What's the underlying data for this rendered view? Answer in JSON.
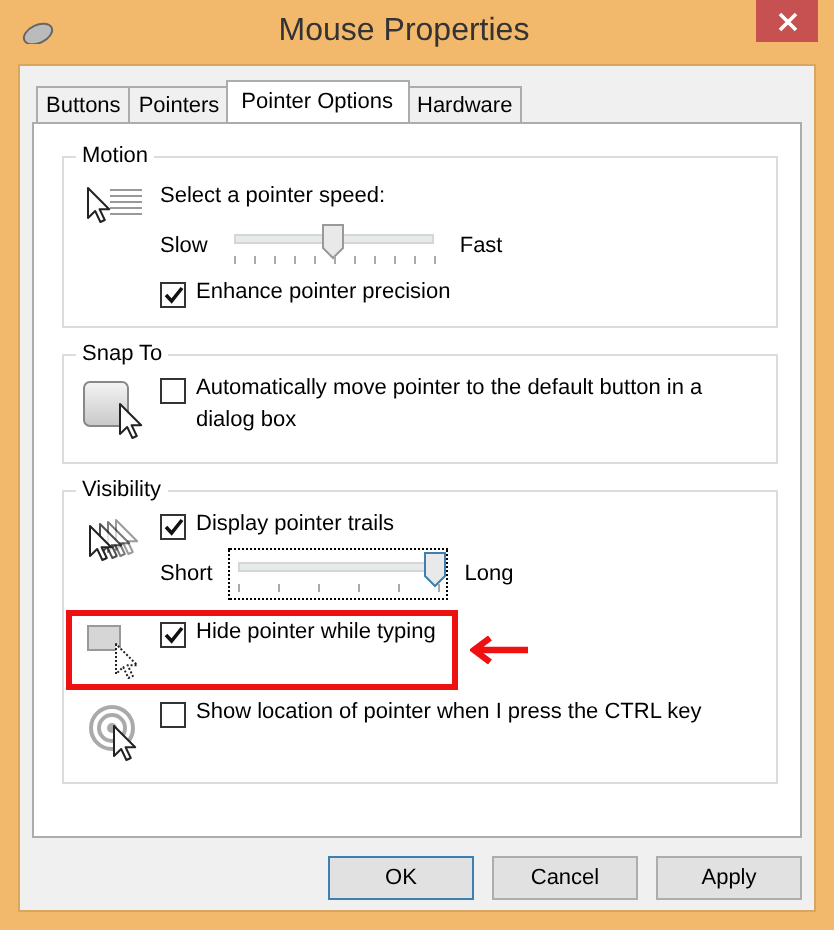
{
  "window": {
    "title": "Mouse Properties"
  },
  "tabs": [
    {
      "label": "Buttons",
      "selected": false
    },
    {
      "label": "Pointers",
      "selected": false
    },
    {
      "label": "Pointer Options",
      "selected": true
    },
    {
      "label": "Hardware",
      "selected": false
    }
  ],
  "groups": [
    {
      "title": "Motion",
      "rows": [
        {
          "highlighted": false,
          "items": [
            {
              "kind": "caption",
              "label": "Select a pointer speed:"
            },
            {
              "kind": "slider",
              "min_label": "Slow",
              "max_label": "Fast",
              "level": 0.5,
              "focused": false
            },
            {
              "kind": "checkbox",
              "label": "Enhance pointer precision",
              "checked": true
            }
          ]
        }
      ]
    },
    {
      "title": "Snap To",
      "rows": [
        {
          "highlighted": false,
          "items": [
            {
              "kind": "checkbox",
              "label": "Automatically move pointer to the default button in a dialog box",
              "checked": false
            }
          ]
        }
      ]
    },
    {
      "title": "Visibility",
      "rows": [
        {
          "highlighted": false,
          "items": [
            {
              "kind": "checkbox",
              "label": "Display pointer trails",
              "checked": true
            },
            {
              "kind": "slider",
              "min_label": "Short",
              "max_label": "Long",
              "level": 1,
              "focused": true
            }
          ]
        },
        {
          "highlighted": true,
          "items": [
            {
              "kind": "checkbox",
              "label": "Hide pointer while typing",
              "checked": true
            }
          ]
        },
        {
          "highlighted": false,
          "items": [
            {
              "kind": "checkbox",
              "label": "Show location of pointer when I press the CTRL key",
              "checked": false
            }
          ]
        }
      ]
    }
  ],
  "buttons": [
    {
      "label": "OK",
      "default": true
    },
    {
      "label": "Cancel",
      "default": false
    },
    {
      "label": "Apply",
      "default": false
    }
  ]
}
